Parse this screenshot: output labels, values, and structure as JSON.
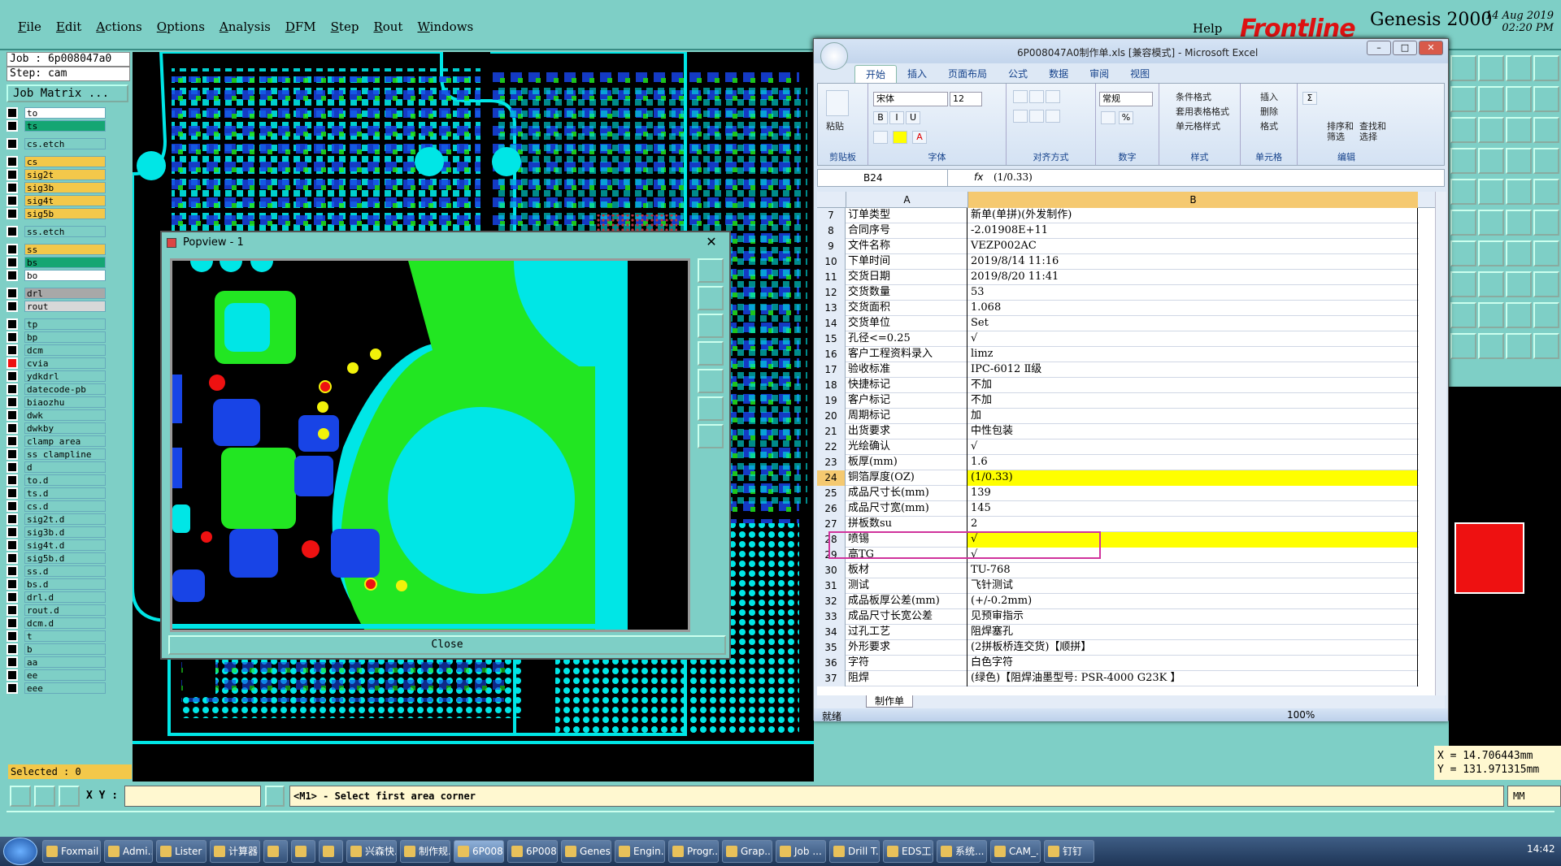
{
  "menubar": {
    "items": [
      "File",
      "Edit",
      "Actions",
      "Options",
      "Analysis",
      "DFM",
      "Step",
      "Rout",
      "Windows"
    ],
    "help": "Help",
    "brand_logo": "Frontline",
    "brand_name": "Genesis 2000",
    "date": "14 Aug 2019",
    "time": "02:20 PM"
  },
  "leftpanel": {
    "job": "Job : 6p008047a0",
    "step": "Step: cam",
    "job_matrix": "Job Matrix ...",
    "layers": [
      {
        "name": "to",
        "color": "#ffffff"
      },
      {
        "name": "ts",
        "color": "#15a673"
      },
      {
        "name": "cs.etch",
        "color": "#7ecfc6",
        "gap": true
      },
      {
        "name": "cs",
        "color": "#f3c84a",
        "gap": true
      },
      {
        "name": "sig2t",
        "color": "#f3c84a"
      },
      {
        "name": "sig3b",
        "color": "#f3c84a"
      },
      {
        "name": "sig4t",
        "color": "#f3c84a"
      },
      {
        "name": "sig5b",
        "color": "#f3c84a"
      },
      {
        "name": "ss.etch",
        "color": "#7ecfc6",
        "gap": true
      },
      {
        "name": "ss",
        "color": "#f3c84a",
        "gap": true
      },
      {
        "name": "bs",
        "color": "#15a673"
      },
      {
        "name": "bo",
        "color": "#ffffff"
      },
      {
        "name": "drl",
        "color": "#a8a8a8",
        "gap": true
      },
      {
        "name": "rout",
        "color": "#d8d8d8"
      },
      {
        "name": "tp",
        "color": "#7ecfc6",
        "gap": true
      },
      {
        "name": "bp",
        "color": "#7ecfc6"
      },
      {
        "name": "dcm",
        "color": "#7ecfc6"
      },
      {
        "name": "cvia",
        "color": "#7ecfc6",
        "mark": "#ee1111"
      },
      {
        "name": "ydkdrl",
        "color": "#7ecfc6"
      },
      {
        "name": "datecode-pb",
        "color": "#7ecfc6"
      },
      {
        "name": "biaozhu",
        "color": "#7ecfc6"
      },
      {
        "name": "dwk",
        "color": "#7ecfc6"
      },
      {
        "name": "dwkby",
        "color": "#7ecfc6"
      },
      {
        "name": "clamp_area",
        "color": "#7ecfc6"
      },
      {
        "name": "ss_clampline",
        "color": "#7ecfc6"
      },
      {
        "name": "d",
        "color": "#7ecfc6"
      },
      {
        "name": "to.d",
        "color": "#7ecfc6"
      },
      {
        "name": "ts.d",
        "color": "#7ecfc6"
      },
      {
        "name": "cs.d",
        "color": "#7ecfc6"
      },
      {
        "name": "sig2t.d",
        "color": "#7ecfc6"
      },
      {
        "name": "sig3b.d",
        "color": "#7ecfc6"
      },
      {
        "name": "sig4t.d",
        "color": "#7ecfc6"
      },
      {
        "name": "sig5b.d",
        "color": "#7ecfc6"
      },
      {
        "name": "ss.d",
        "color": "#7ecfc6"
      },
      {
        "name": "bs.d",
        "color": "#7ecfc6"
      },
      {
        "name": "drl.d",
        "color": "#7ecfc6"
      },
      {
        "name": "rout.d",
        "color": "#7ecfc6"
      },
      {
        "name": "dcm.d",
        "color": "#7ecfc6"
      },
      {
        "name": "t",
        "color": "#7ecfc6"
      },
      {
        "name": "b",
        "color": "#7ecfc6"
      },
      {
        "name": "aa",
        "color": "#7ecfc6"
      },
      {
        "name": "ee",
        "color": "#7ecfc6"
      },
      {
        "name": "eee",
        "color": "#7ecfc6"
      }
    ],
    "selected": "Selected : 0"
  },
  "bottombar": {
    "xy_label": "X Y :",
    "xy_value": "",
    "prompt": "<M1> - Select first area corner",
    "units": "MM"
  },
  "coords": {
    "x": "X = 14.706443mm",
    "y": "Y = 131.971315mm"
  },
  "popview": {
    "title": "Popview - 1",
    "close_label": "Close"
  },
  "excel": {
    "title": "6P008047A0制作单.xls [兼容模式] - Microsoft Excel",
    "tabs": [
      "开始",
      "插入",
      "页面布局",
      "公式",
      "数据",
      "审阅",
      "视图"
    ],
    "ribbon": {
      "paste": "粘贴",
      "clipboard": "剪贴板",
      "font_name": "宋体",
      "font_size": "12",
      "font": "字体",
      "align": "对齐方式",
      "number_format": "常规",
      "number": "数字",
      "cond_format": "条件格式",
      "table_format": "套用表格格式",
      "cell_style": "单元格样式",
      "style": "样式",
      "insert": "插入",
      "delete": "删除",
      "format": "格式",
      "cells": "单元格",
      "sort_filter": "排序和\n筛选",
      "find_select": "查找和\n选择",
      "editing": "编辑"
    },
    "namebox": "B24",
    "formula": "(1/0.33)",
    "col_a": "A",
    "col_b": "B",
    "rows": [
      {
        "n": "7",
        "a": "订单类型",
        "b": "新单(单拼)(外发制作)"
      },
      {
        "n": "8",
        "a": "合同序号",
        "b": "-2.01908E+11"
      },
      {
        "n": "9",
        "a": "文件名称",
        "b": "VEZP002AC"
      },
      {
        "n": "10",
        "a": "下单时间",
        "b": "2019/8/14 11:16"
      },
      {
        "n": "11",
        "a": "交货日期",
        "b": "2019/8/20 11:41"
      },
      {
        "n": "12",
        "a": "交货数量",
        "b": "53"
      },
      {
        "n": "13",
        "a": "交货面积",
        "b": "1.068"
      },
      {
        "n": "14",
        "a": "交货单位",
        "b": "Set"
      },
      {
        "n": "15",
        "a": "孔径<=0.25",
        "b": "√"
      },
      {
        "n": "16",
        "a": "客户工程资料录入",
        "b": "limz"
      },
      {
        "n": "17",
        "a": "验收标准",
        "b": "IPC-6012 Ⅱ级"
      },
      {
        "n": "18",
        "a": "快捷标记",
        "b": "不加"
      },
      {
        "n": "19",
        "a": "客户标记",
        "b": "不加"
      },
      {
        "n": "20",
        "a": "周期标记",
        "b": "加"
      },
      {
        "n": "21",
        "a": "出货要求",
        "b": "中性包装"
      },
      {
        "n": "22",
        "a": "光绘确认",
        "b": "√"
      },
      {
        "n": "23",
        "a": "板厚(mm)",
        "b": "1.6"
      },
      {
        "n": "24",
        "a": "铜箔厚度(OZ)",
        "b": "(1/0.33)",
        "hl": true,
        "sel": true
      },
      {
        "n": "25",
        "a": "成品尺寸长(mm)",
        "b": "139"
      },
      {
        "n": "26",
        "a": "成品尺寸宽(mm)",
        "b": "145"
      },
      {
        "n": "27",
        "a": "拼板数su",
        "b": "2"
      },
      {
        "n": "28",
        "a": "喷锡",
        "b": "√",
        "hl": true
      },
      {
        "n": "29",
        "a": "高TG",
        "b": "√"
      },
      {
        "n": "30",
        "a": "板材",
        "b": "TU-768"
      },
      {
        "n": "31",
        "a": "测试",
        "b": "飞针测试"
      },
      {
        "n": "32",
        "a": "成品板厚公差(mm)",
        "b": "(+/-0.2mm)"
      },
      {
        "n": "33",
        "a": "成品尺寸长宽公差",
        "b": "见预审指示"
      },
      {
        "n": "34",
        "a": "过孔工艺",
        "b": "阻焊塞孔"
      },
      {
        "n": "35",
        "a": "外形要求",
        "b": "(2拼板桥连交货)【顺拼】"
      },
      {
        "n": "36",
        "a": "字符",
        "b": "白色字符"
      },
      {
        "n": "37",
        "a": "阻焊",
        "b": "(绿色)【阻焊油墨型号: PSR-4000 G23K 】"
      }
    ],
    "sheet_tab": "制作单",
    "status": "就绪",
    "zoom": "100%"
  },
  "taskbar": {
    "items": [
      "Foxmail",
      "Admi...",
      "Lister ...",
      "计算器",
      "",
      "",
      "",
      "兴森快...",
      "制作规...",
      "6P008...",
      "6P008...",
      "Genesis",
      "Engin...",
      "Progr...",
      "Grap...",
      "Job ...",
      "Drill T...",
      "EDS工...",
      "系统...",
      "CAM_...",
      "钉钉"
    ],
    "time": "14:42"
  }
}
